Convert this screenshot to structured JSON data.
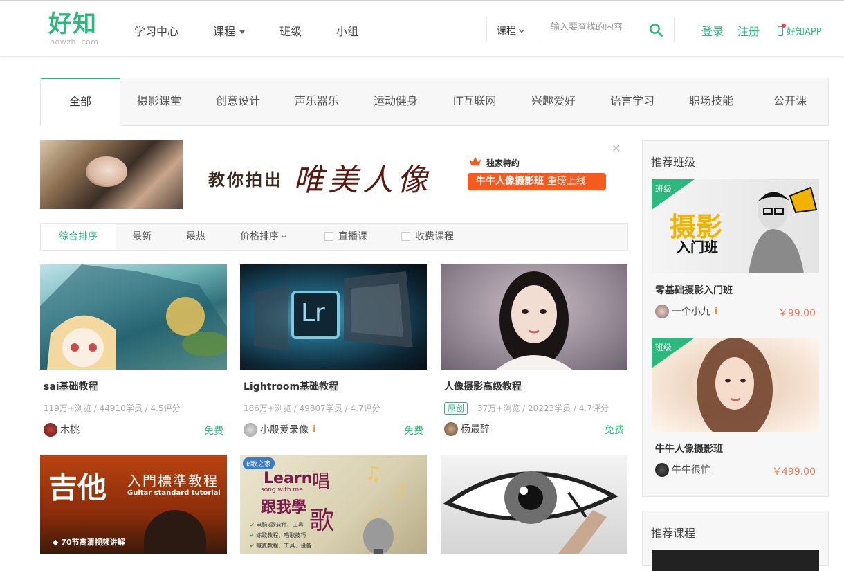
{
  "header": {
    "logo_cn": "好知",
    "logo_en": "howzhi.com",
    "nav": [
      "学习中心",
      "课程",
      "班级",
      "小组"
    ],
    "search_scope": "课程",
    "search_placeholder": "输入要查找的内容",
    "login": "登录",
    "register": "注册",
    "app": "好知APP"
  },
  "categories": [
    "全部",
    "摄影课堂",
    "创意设计",
    "声乐器乐",
    "运动健身",
    "IT互联网",
    "兴趣爱好",
    "语言学习",
    "职场技能",
    "公开课"
  ],
  "banner": {
    "text1": "教你拍出",
    "text2": "唯美人像",
    "exclusive": "独家特约",
    "pill_bold": "牛牛人像摄影班",
    "pill_rest": "重磅上线"
  },
  "sort": {
    "items": [
      "综合排序",
      "最新",
      "最热",
      "价格排序"
    ],
    "checks": [
      "直播课",
      "收费课程"
    ]
  },
  "courses": [
    {
      "title": "sai基础教程",
      "views": "119万+浏览",
      "students": "44910学员",
      "rating": "4.5评分",
      "author": "木桃",
      "price": "免费",
      "original": ""
    },
    {
      "title": "Lightroom基础教程",
      "views": "186万+浏览",
      "students": "49807学员",
      "rating": "4.7评分",
      "author": "小殷爱录像",
      "price": "免费",
      "original": ""
    },
    {
      "title": "人像摄影高级教程",
      "views": "37万+浏览",
      "students": "20223学员",
      "rating": "4.7评分",
      "author": "杨最醉",
      "price": "免费",
      "original": "原创"
    }
  ],
  "row2": {
    "guitar_title": "吉他",
    "guitar_sub": "入門標準教程",
    "guitar_en": "Guitar standard tutorial",
    "guitar_note": "◆ 70节高清视频讲解",
    "sing_logo": "k歌之家",
    "sing_learn": "Learn",
    "sing_cn1": "唱",
    "sing_en": "song with me",
    "sing_cn2": "跟我學",
    "sing_cn3": "歌",
    "sing_items": [
      "电脑k歌软件、工具",
      "练歌教程、唱歌技巧",
      "喊麦教程、工具、设备"
    ],
    "lr_text": "Lr"
  },
  "sidebar": {
    "title": "推荐班级",
    "classes": [
      {
        "tag": "班级",
        "poster1": "摄影",
        "poster2": "入门班",
        "title": "零基础摄影入门班",
        "author": "一个小九",
        "price": "￥99.00"
      },
      {
        "tag": "班级",
        "title": "牛牛人像摄影班",
        "author": "牛牛很忙",
        "price": "￥499.00"
      }
    ],
    "title2": "推荐课程"
  },
  "vip_mark": "i"
}
